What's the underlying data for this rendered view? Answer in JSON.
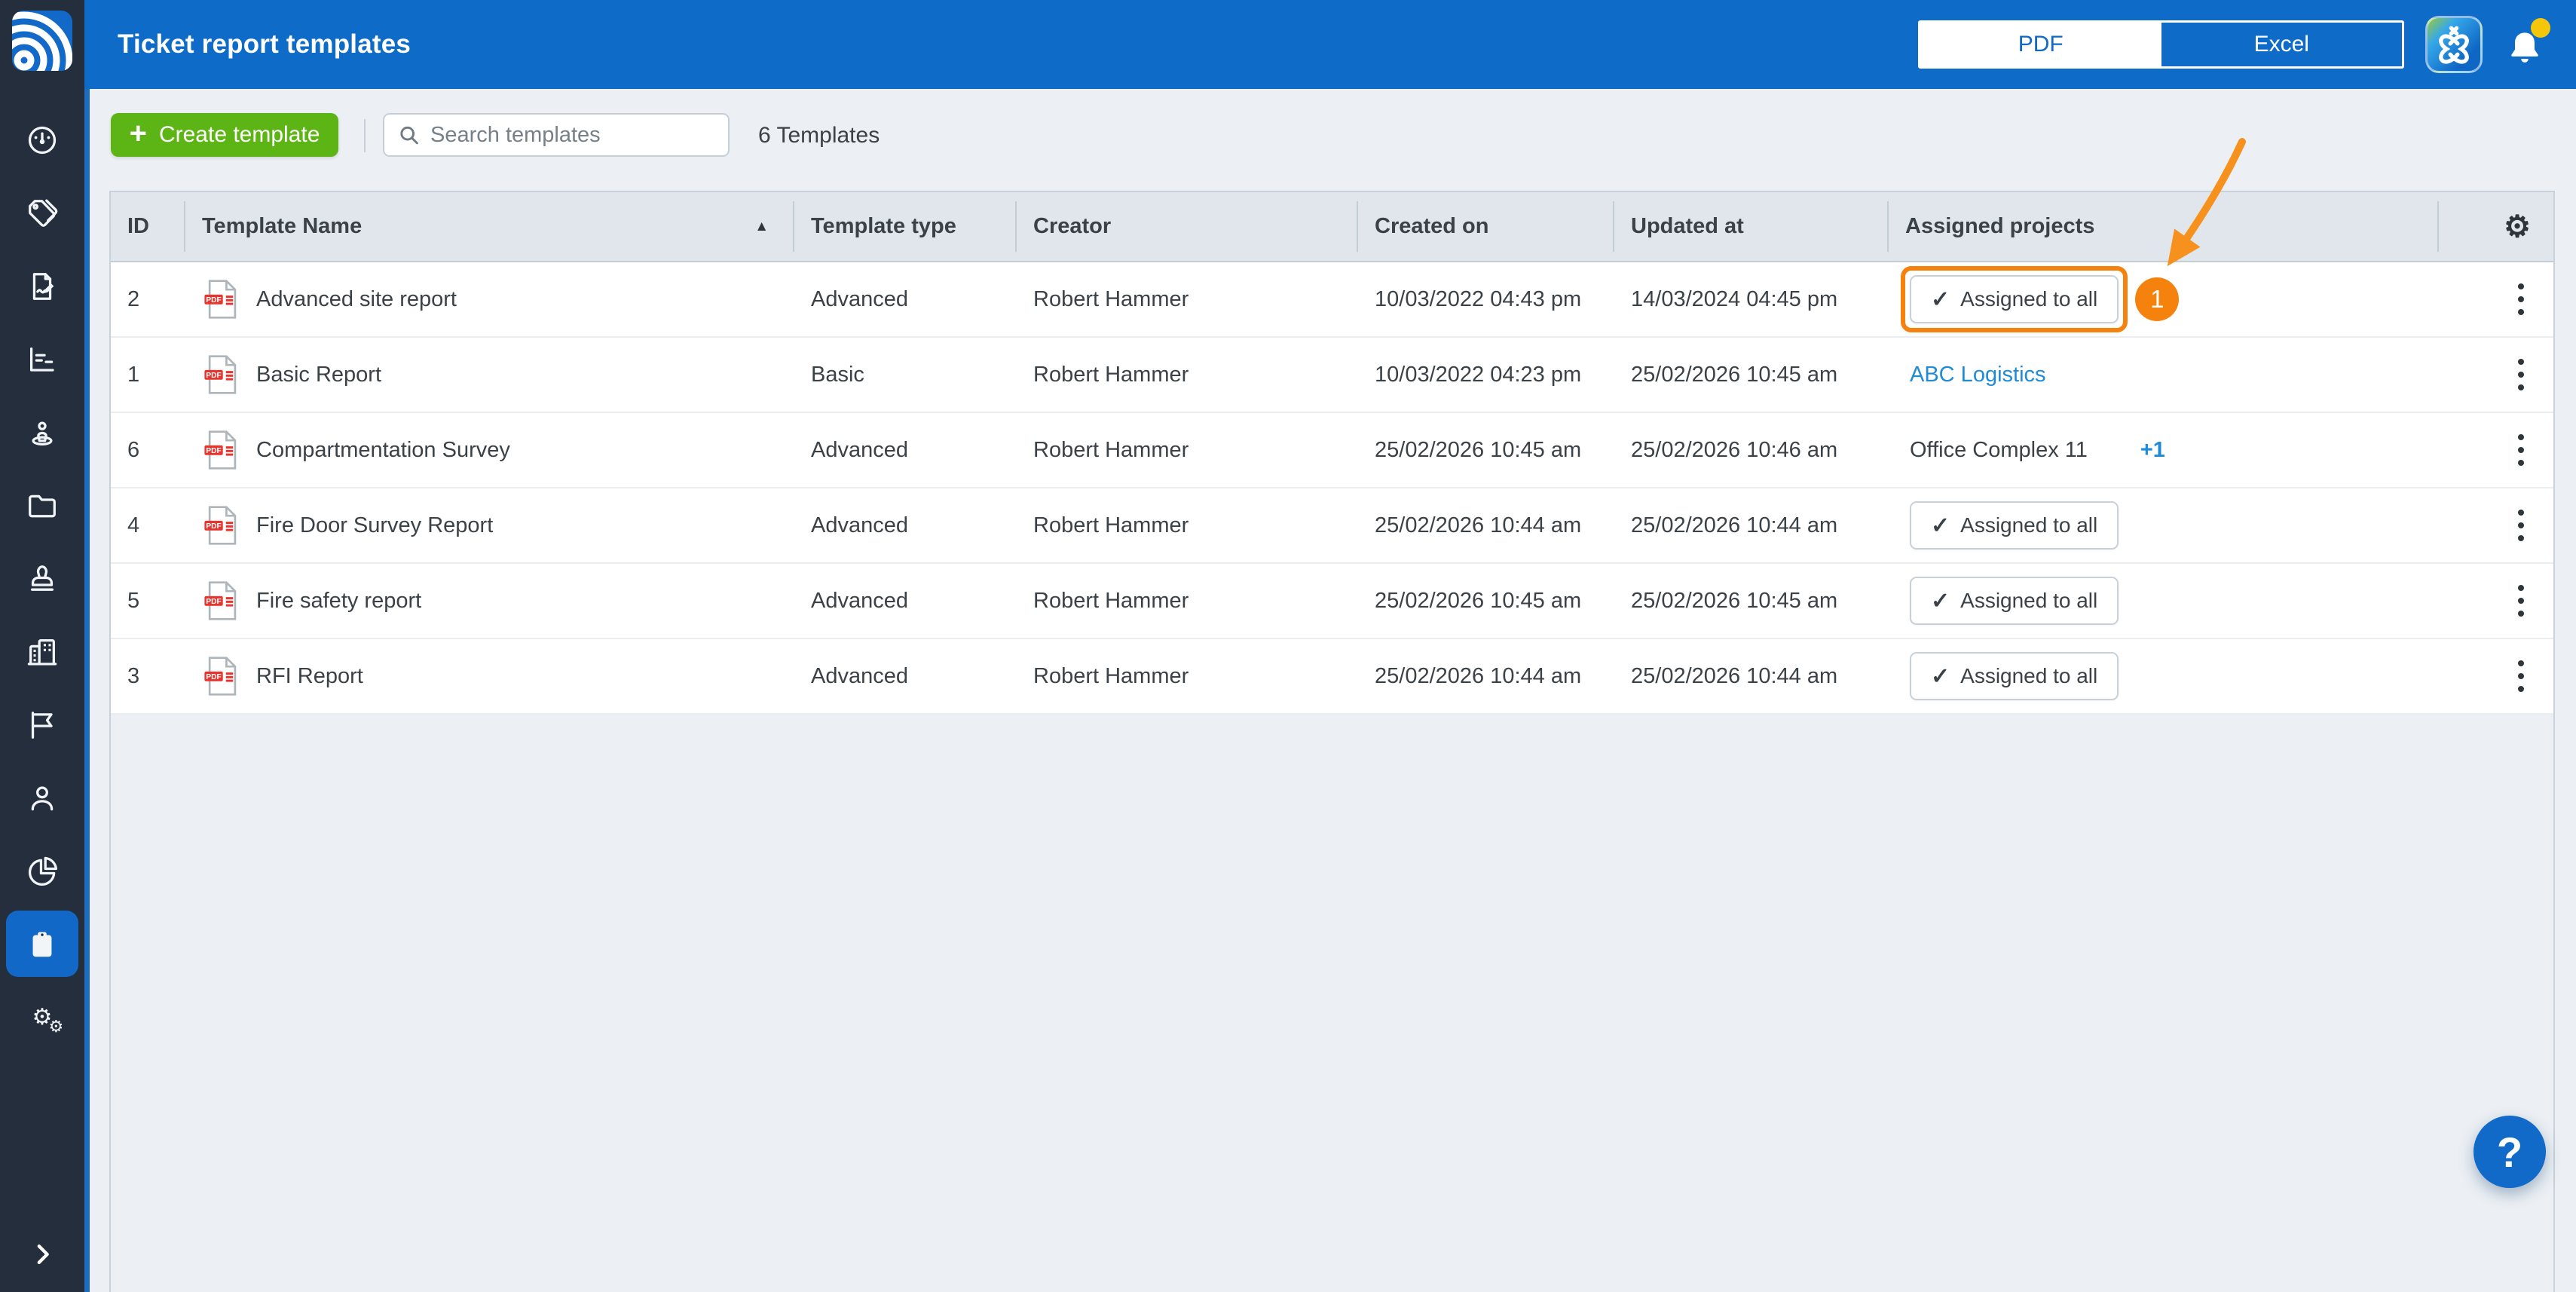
{
  "header": {
    "title": "Ticket report templates",
    "format_toggle": {
      "options": [
        "PDF",
        "Excel"
      ],
      "selected": "PDF"
    }
  },
  "sidebar": {
    "items": [
      "dashboard",
      "tags",
      "forms",
      "reports-chart",
      "site-person",
      "documents-folder",
      "stamp",
      "company-buildings",
      "flag",
      "users",
      "statistics-pie",
      "report-templates",
      "settings-gears"
    ],
    "active_item": "report-templates"
  },
  "toolbar": {
    "create_label": "Create template",
    "create_plus": "+",
    "search_placeholder": "Search templates",
    "count": "6 Templates"
  },
  "table": {
    "columns": [
      "ID",
      "Template Name",
      "Template type",
      "Creator",
      "Created on",
      "Updated at",
      "Assigned projects"
    ],
    "sort": {
      "column": "Template Name",
      "direction": "asc",
      "glyph": "▲"
    },
    "pdf_badge": "PDF",
    "assigned_check": "✓",
    "rows": [
      {
        "id": "2",
        "name": "Advanced site report",
        "type": "Advanced",
        "creator": "Robert Hammer",
        "created": "10/03/2022 04:43 pm",
        "updated": "14/03/2024 04:45 pm",
        "assigned": {
          "kind": "button",
          "label": "Assigned to all",
          "highlighted": true
        }
      },
      {
        "id": "1",
        "name": "Basic Report",
        "type": "Basic",
        "creator": "Robert Hammer",
        "created": "10/03/2022 04:23 pm",
        "updated": "25/02/2026 10:45 am",
        "assigned": {
          "kind": "link",
          "label": "ABC Logistics"
        }
      },
      {
        "id": "6",
        "name": "Compartmentation Survey",
        "type": "Advanced",
        "creator": "Robert Hammer",
        "created": "25/02/2026 10:45 am",
        "updated": "25/02/2026 10:46 am",
        "assigned": {
          "kind": "text_plus",
          "label": "Office Complex 11",
          "more": "+1"
        }
      },
      {
        "id": "4",
        "name": "Fire Door Survey Report",
        "type": "Advanced",
        "creator": "Robert Hammer",
        "created": "25/02/2026 10:44 am",
        "updated": "25/02/2026 10:44 am",
        "assigned": {
          "kind": "button",
          "label": "Assigned to all",
          "highlighted": false
        }
      },
      {
        "id": "5",
        "name": "Fire safety report",
        "type": "Advanced",
        "creator": "Robert Hammer",
        "created": "25/02/2026 10:45 am",
        "updated": "25/02/2026 10:45 am",
        "assigned": {
          "kind": "button",
          "label": "Assigned to all",
          "highlighted": false
        }
      },
      {
        "id": "3",
        "name": "RFI Report",
        "type": "Advanced",
        "creator": "Robert Hammer",
        "created": "25/02/2026 10:44 am",
        "updated": "25/02/2026 10:44 am",
        "assigned": {
          "kind": "button",
          "label": "Assigned to all",
          "highlighted": false
        }
      }
    ]
  },
  "annotation": {
    "badge": "1"
  },
  "help": {
    "label": "?"
  },
  "colors": {
    "topbar": "#0E6BC8",
    "sidebar": "#242E3D",
    "accent_blue": "#1168C6",
    "green_button": "#5CB514",
    "orange_annotation": "#F5820D",
    "link_blue": "#1F8BD6",
    "notification_dot": "#F6C60A",
    "page_bg": "#ECF0F4"
  }
}
